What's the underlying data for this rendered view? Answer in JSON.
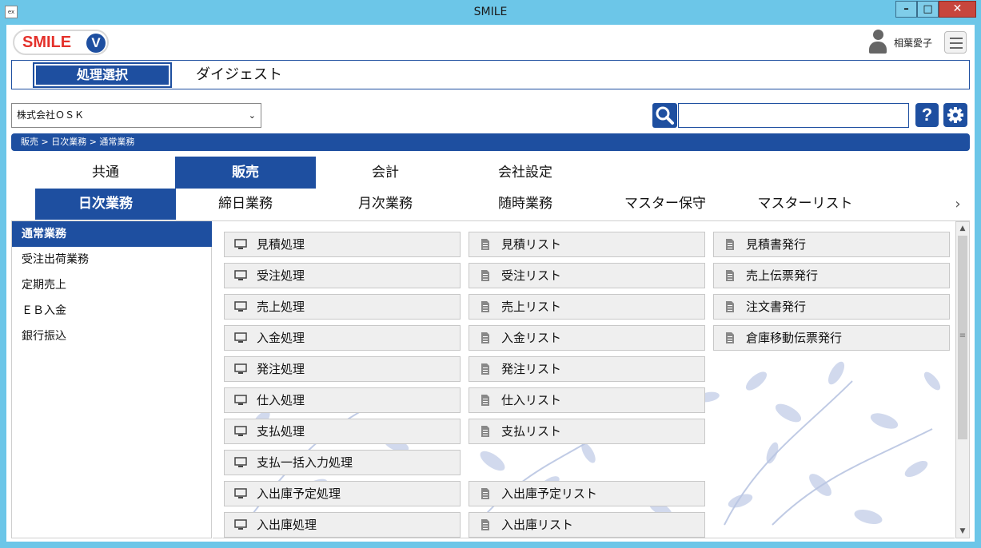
{
  "window": {
    "title": "SMILE",
    "app_icon": "ex",
    "minimize_glyph": "–",
    "maximize_glyph": "□",
    "close_glyph": "✕"
  },
  "header": {
    "logo_text": "SMILE",
    "logo_badge": "V",
    "user_name": "相葉愛子"
  },
  "modes": {
    "active": "処理選択",
    "other": "ダイジェスト"
  },
  "company": {
    "selected": "株式会社ＯＳＫ",
    "arrow": "⌄"
  },
  "search": {
    "placeholder": ""
  },
  "toolbar": {
    "help_label": "?",
    "settings_glyph": "✲"
  },
  "breadcrumb": "販売 > 日次業務 > 通常業務",
  "category_tabs": [
    "共通",
    "販売",
    "会計",
    "会社設定"
  ],
  "sub_tabs": [
    "日次業務",
    "締日業務",
    "月次業務",
    "随時業務",
    "マスター保守",
    "マスターリスト"
  ],
  "sub_next": "›",
  "left_menu": [
    "通常業務",
    "受注出荷業務",
    "定期売上",
    "ＥＢ入金",
    "銀行振込"
  ],
  "functions": {
    "col1": [
      "見積処理",
      "受注処理",
      "売上処理",
      "入金処理",
      "発注処理",
      "仕入処理",
      "支払処理",
      "支払一括入力処理",
      "入出庫予定処理",
      "入出庫処理"
    ],
    "col2": [
      "見積リスト",
      "受注リスト",
      "売上リスト",
      "入金リスト",
      "発注リスト",
      "仕入リスト",
      "支払リスト",
      "",
      "入出庫予定リスト",
      "入出庫リスト"
    ],
    "col3": [
      "見積書発行",
      "売上伝票発行",
      "注文書発行",
      "倉庫移動伝票発行"
    ]
  },
  "scrollbar": {
    "up": "▲",
    "down": "▼",
    "grip": "≡"
  },
  "colors": {
    "accent": "#1e4fa0",
    "titlebar": "#6cc6e8",
    "logo_red": "#e4312b"
  }
}
